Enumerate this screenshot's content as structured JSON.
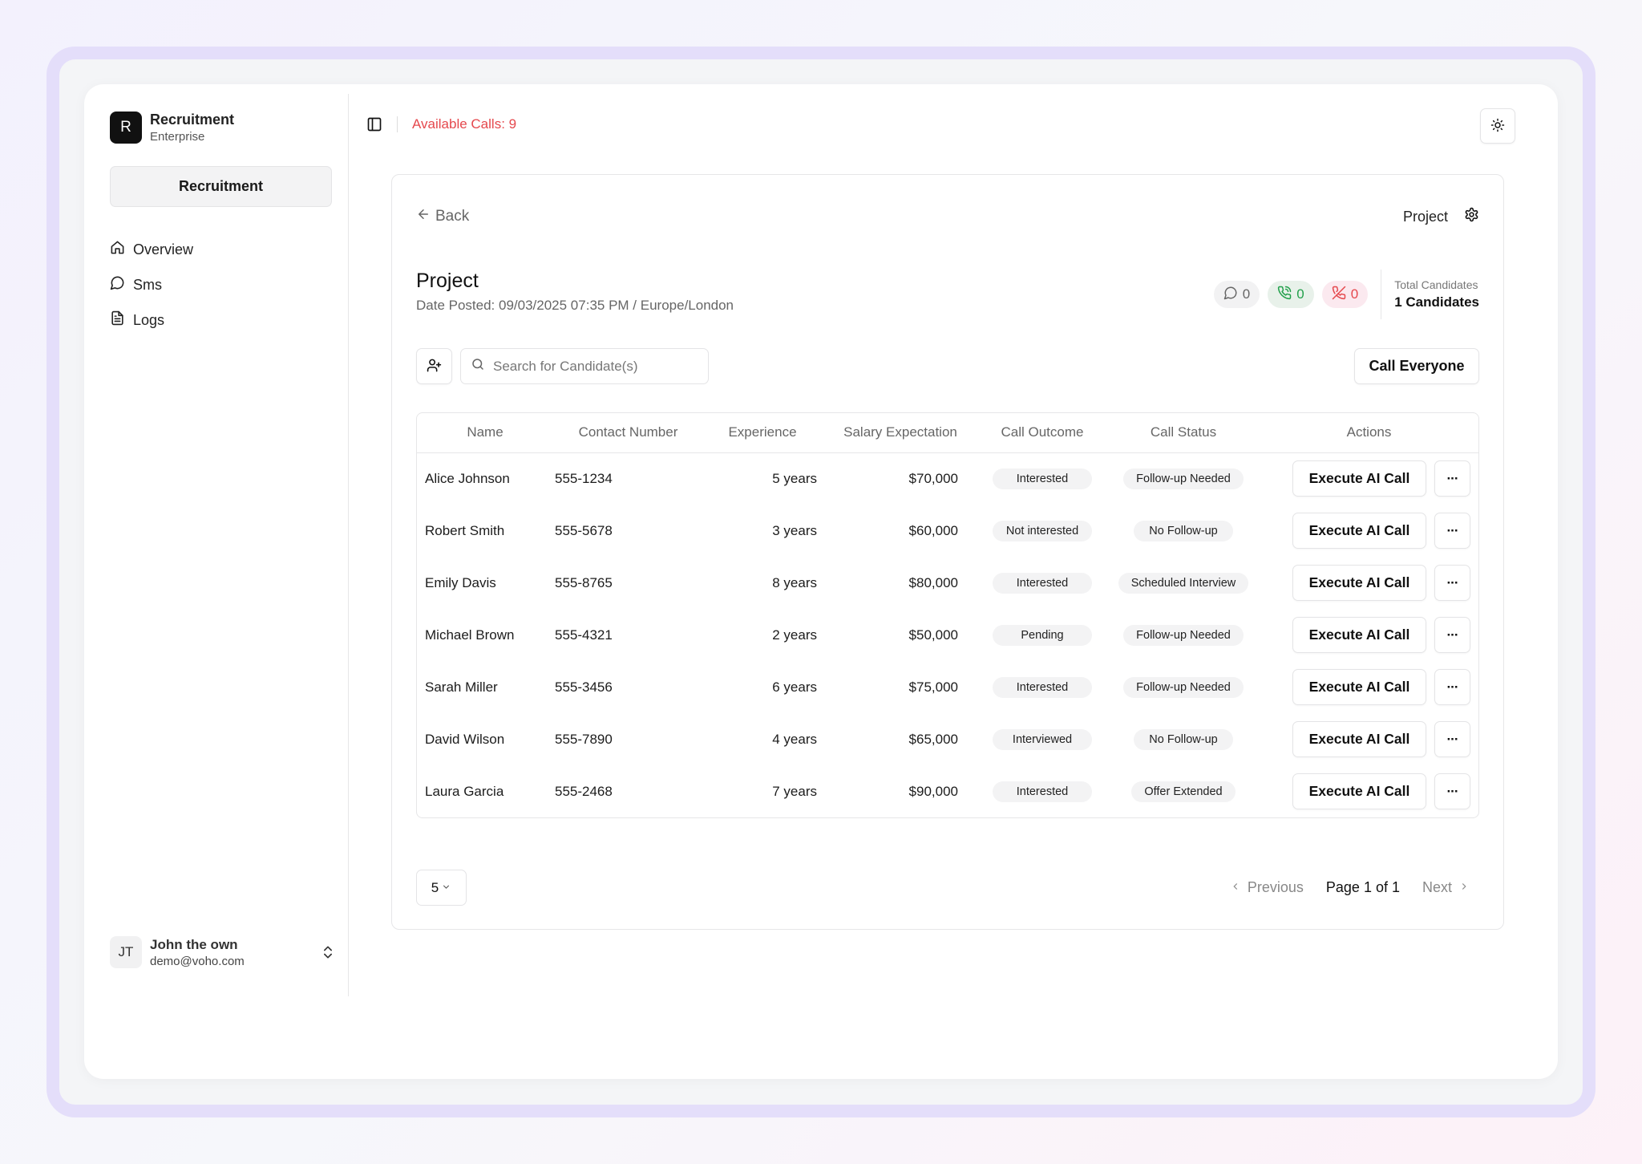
{
  "brand": {
    "logo_letter": "R",
    "name": "Recruitment",
    "plan": "Enterprise"
  },
  "sidebar": {
    "project_button": "Recruitment",
    "items": [
      {
        "label": "Overview",
        "icon": "home-icon"
      },
      {
        "label": "Sms",
        "icon": "message-circle-icon"
      },
      {
        "label": "Logs",
        "icon": "file-text-icon"
      }
    ]
  },
  "user": {
    "initials": "JT",
    "name": "John the own",
    "email": "demo@voho.com"
  },
  "topbar": {
    "available_calls": "Available Calls: 9"
  },
  "colors": {
    "accent_red": "#e5484d",
    "success_green": "#22a04b"
  },
  "project": {
    "back_label": "Back",
    "settings_label": "Project",
    "title": "Project",
    "date_posted": "Date Posted: 09/03/2025 07:35 PM / Europe/London",
    "stats": {
      "sms": "0",
      "answered_calls": "0",
      "missed_calls": "0"
    },
    "total_label": "Total Candidates",
    "total_value": "1 Candidates"
  },
  "toolbar": {
    "search_placeholder": "Search for Candidate(s)",
    "search_value": "",
    "call_everyone": "Call Everyone"
  },
  "table": {
    "headers": [
      "Name",
      "Contact Number",
      "Experience",
      "Salary Expectation",
      "Call Outcome",
      "Call Status",
      "Actions"
    ],
    "action_label": "Execute AI Call",
    "more_label": "···",
    "rows": [
      {
        "name": "Alice Johnson",
        "contact": "555-1234",
        "experience": "5 years",
        "salary": "$70,000",
        "outcome": "Interested",
        "status": "Follow-up Needed"
      },
      {
        "name": "Robert Smith",
        "contact": "555-5678",
        "experience": "3 years",
        "salary": "$60,000",
        "outcome": "Not interested",
        "status": "No Follow-up"
      },
      {
        "name": "Emily Davis",
        "contact": "555-8765",
        "experience": "8 years",
        "salary": "$80,000",
        "outcome": "Interested",
        "status": "Scheduled Interview"
      },
      {
        "name": "Michael Brown",
        "contact": "555-4321",
        "experience": "2 years",
        "salary": "$50,000",
        "outcome": "Pending",
        "status": "Follow-up Needed"
      },
      {
        "name": "Sarah Miller",
        "contact": "555-3456",
        "experience": "6 years",
        "salary": "$75,000",
        "outcome": "Interested",
        "status": "Follow-up Needed"
      },
      {
        "name": "David Wilson",
        "contact": "555-7890",
        "experience": "4 years",
        "salary": "$65,000",
        "outcome": "Interviewed",
        "status": "No Follow-up"
      },
      {
        "name": "Laura Garcia",
        "contact": "555-2468",
        "experience": "7 years",
        "salary": "$90,000",
        "outcome": "Interested",
        "status": "Offer Extended"
      }
    ]
  },
  "pagination": {
    "page_size": "5",
    "previous": "Previous",
    "page_info": "Page 1 of 1",
    "next": "Next"
  }
}
